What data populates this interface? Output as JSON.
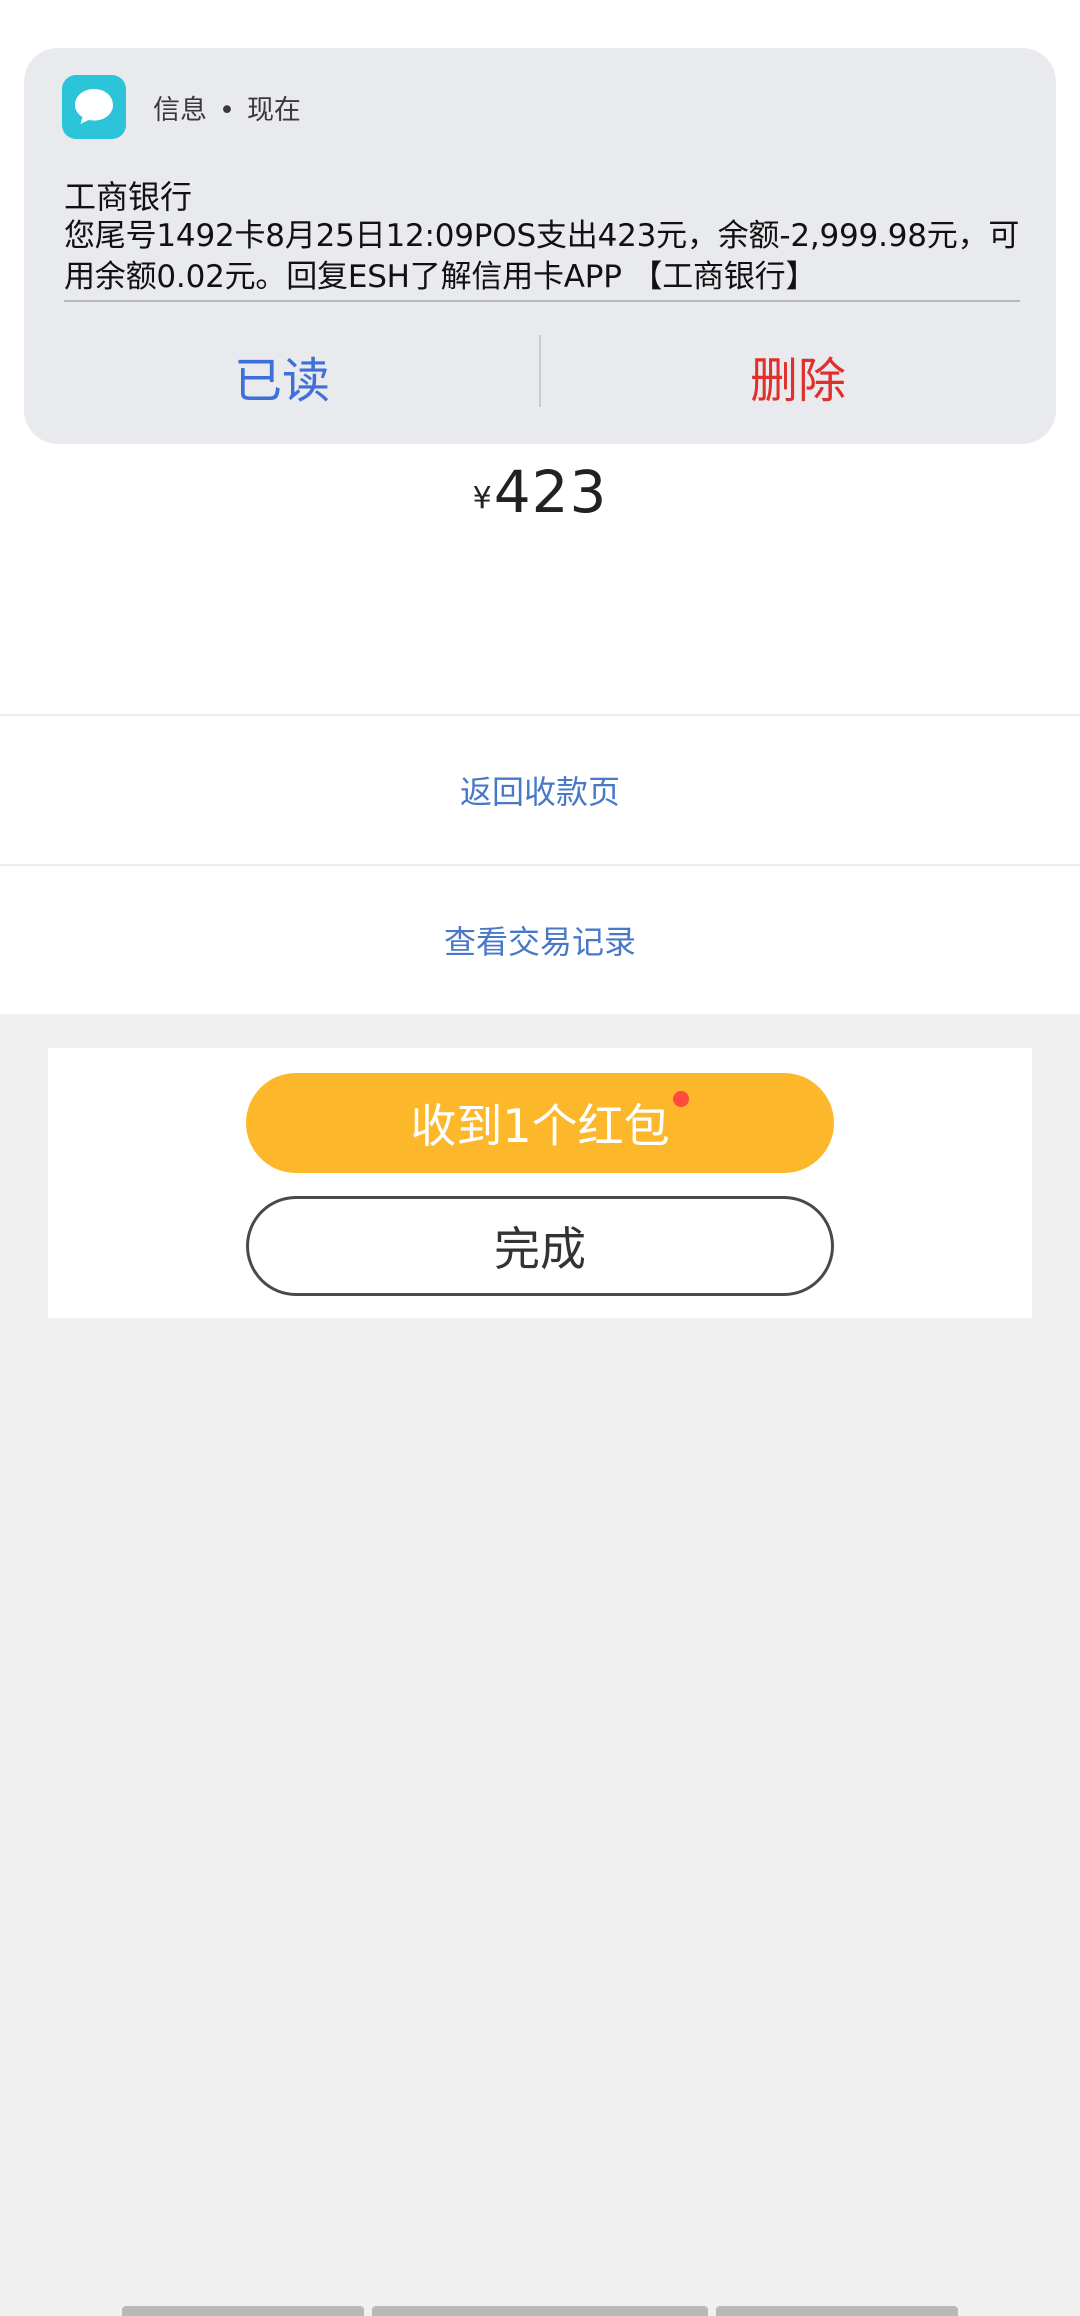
{
  "notification": {
    "app_name": "信息",
    "separator": "•",
    "time": "现在",
    "sender": "工商银行",
    "body": "您尾号1492卡8月25日12:09POS支出423元，余额-2,999.98元，可用余额0.02元。回复ESH了解信用卡APP 【工商银行】",
    "actions": {
      "read": "已读",
      "delete": "删除"
    },
    "icon": "message-bubble-icon"
  },
  "payment": {
    "currency_symbol": "¥",
    "amount": "423"
  },
  "links": {
    "back": "返回收款页",
    "history": "查看交易记录"
  },
  "buttons": {
    "redpack": "收到1个红包",
    "done": "完成"
  },
  "colors": {
    "accent_link": "#4a78c9",
    "redpack_bg": "#fdb72b",
    "read_blue": "#3f6fd8",
    "delete_red": "#e0302e",
    "badge_dot": "#ff4a3d"
  }
}
